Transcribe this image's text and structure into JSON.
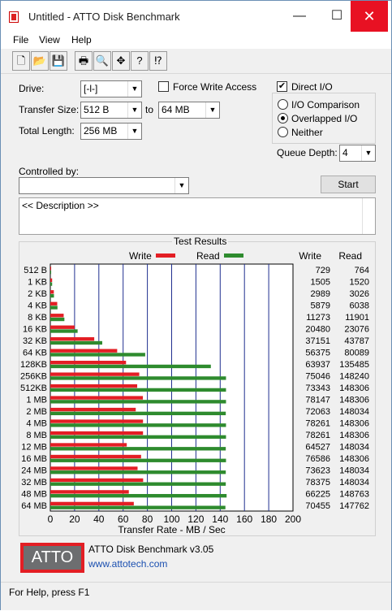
{
  "window": {
    "title": "Untitled - ATTO Disk Benchmark",
    "minimize": "—",
    "maximize": "☐",
    "close": "✕"
  },
  "menu": [
    "File",
    "View",
    "Help"
  ],
  "toolbar": [
    "new-icon",
    "open-icon",
    "save-icon",
    "print-icon",
    "print-preview-icon",
    "move-icon",
    "help-icon",
    "context-help-icon"
  ],
  "form": {
    "drive_label": "Drive:",
    "drive_value": "[-l-]",
    "force_write_label": "Force Write Access",
    "force_write_checked": false,
    "direct_io_label": "Direct I/O",
    "direct_io_checked": true,
    "transfer_size_label": "Transfer Size:",
    "transfer_from": "512 B",
    "to_label": "to",
    "transfer_to": "64 MB",
    "total_length_label": "Total Length:",
    "total_length": "256 MB",
    "io_comparison": "I/O Comparison",
    "overlapped_io": "Overlapped I/O",
    "neither": "Neither",
    "selected_mode": "overlapped_io",
    "queue_depth_label": "Queue Depth:",
    "queue_depth": "4",
    "controlled_by_label": "Controlled by:",
    "controlled_by_value": "",
    "start_button": "Start",
    "description": "<< Description >>"
  },
  "results": {
    "title": "Test Results",
    "legend_write": "Write",
    "legend_read": "Read",
    "col_write": "Write",
    "col_read": "Read"
  },
  "chart_data": {
    "type": "bar",
    "orientation": "horizontal",
    "xlabel": "Transfer Rate - MB / Sec",
    "xlim": [
      0,
      200
    ],
    "xticks": [
      0,
      20,
      40,
      60,
      80,
      100,
      120,
      140,
      160,
      180,
      200
    ],
    "categories": [
      "512 B",
      "1 KB",
      "2 KB",
      "4 KB",
      "8 KB",
      "16 KB",
      "32 KB",
      "64 KB",
      "128KB",
      "256KB",
      "512KB",
      "1 MB",
      "2 MB",
      "4 MB",
      "8 MB",
      "12 MB",
      "16 MB",
      "24 MB",
      "32 MB",
      "48 MB",
      "64 MB"
    ],
    "series": [
      {
        "name": "Write",
        "color": "#e31e24",
        "values": [
          0.7,
          1.5,
          2.9,
          5.7,
          11.0,
          20.0,
          36.2,
          55.1,
          62.4,
          73.3,
          71.6,
          76.3,
          70.4,
          76.4,
          76.4,
          63.0,
          74.8,
          71.9,
          76.5,
          64.7,
          68.8
        ]
      },
      {
        "name": "Read",
        "color": "#2e8b2e",
        "values": [
          0.7,
          1.5,
          3.0,
          5.9,
          11.6,
          22.5,
          42.8,
          78.2,
          132.3,
          144.8,
          144.8,
          144.8,
          144.6,
          144.8,
          144.8,
          144.6,
          144.8,
          144.6,
          144.6,
          145.3,
          144.3
        ]
      }
    ],
    "table_write": [
      "729",
      "1505",
      "2989",
      "5879",
      "11273",
      "20480",
      "37151",
      "56375",
      "63937",
      "75046",
      "73343",
      "78147",
      "72063",
      "78261",
      "78261",
      "64527",
      "76586",
      "73623",
      "78375",
      "66225",
      "70455"
    ],
    "table_read": [
      "764",
      "1520",
      "3026",
      "6038",
      "11901",
      "23076",
      "43787",
      "80089",
      "135485",
      "148240",
      "148306",
      "148306",
      "148034",
      "148306",
      "148306",
      "148034",
      "148306",
      "148034",
      "148034",
      "148763",
      "147762"
    ]
  },
  "footer": {
    "logo_text": "ATTO",
    "product": "ATTO Disk Benchmark v3.05",
    "link": "www.attotech.com"
  },
  "status": "For Help, press F1"
}
